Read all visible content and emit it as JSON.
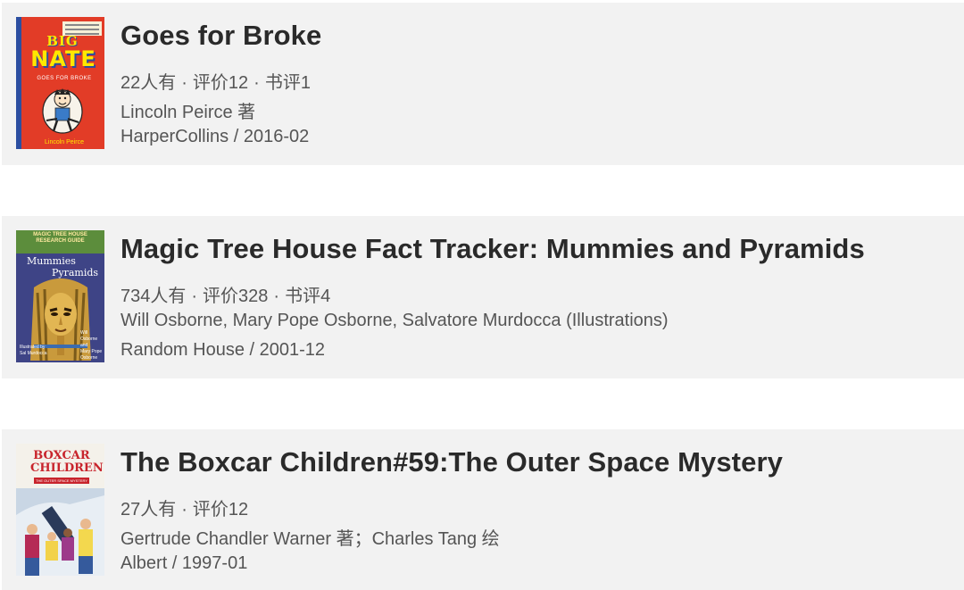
{
  "books": [
    {
      "title": "Goes for Broke",
      "meta": [
        "22人有",
        "评价12",
        "书评1"
      ],
      "author": "Lincoln Peirce 著",
      "publisher": "HarperCollins / 2016-02",
      "cover": {
        "big": "BIG",
        "nate": "NATE",
        "subtitle": "GOES FOR BROKE",
        "author": "Lincoln Peirce",
        "accent": "#e23c27"
      }
    },
    {
      "title": "Magic Tree House Fact Tracker: Mummies and Pyramids",
      "meta": [
        "734人有",
        "评价328",
        "书评4"
      ],
      "author": "Will Osborne, Mary Pope Osborne, Salvatore Murdocca (Illustrations)",
      "publisher": "Random House / 2001-12",
      "cover": {
        "banner": "MAGIC TREE HOUSE RESEARCH GUIDE",
        "word1": "Mummies",
        "word2": "Pyramids",
        "accent": "#3e4486"
      }
    },
    {
      "title": "The Boxcar Children#59:The Outer Space Mystery",
      "meta": [
        "27人有",
        "评价12"
      ],
      "author": "Gertrude Chandler Warner 著；Charles Tang 绘",
      "publisher": "Albert / 1997-01",
      "cover": {
        "word1": "BOXCAR",
        "word2": "CHILDREN",
        "stripe": "THE OUTER SPACE MYSTERY",
        "accent": "#c8242c"
      }
    }
  ]
}
